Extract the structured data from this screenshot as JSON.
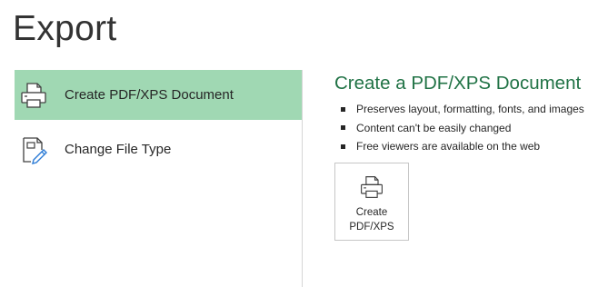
{
  "page": {
    "title": "Export"
  },
  "nav": {
    "items": [
      {
        "label": "Create PDF/XPS Document",
        "icon": "printer-document-icon",
        "selected": true
      },
      {
        "label": "Change File Type",
        "icon": "file-edit-icon",
        "selected": false
      }
    ]
  },
  "detail": {
    "title": "Create a PDF/XPS Document",
    "bullets": [
      "Preserves layout, formatting, fonts, and images",
      "Content can't be easily changed",
      "Free viewers are available on the web"
    ],
    "button": {
      "line1": "Create",
      "line2": "PDF/XPS",
      "icon": "printer-document-icon"
    }
  },
  "colors": {
    "accent_green": "#217346",
    "selected_bg": "#a0d8b3",
    "edit_pen_blue": "#2b7bd6"
  }
}
